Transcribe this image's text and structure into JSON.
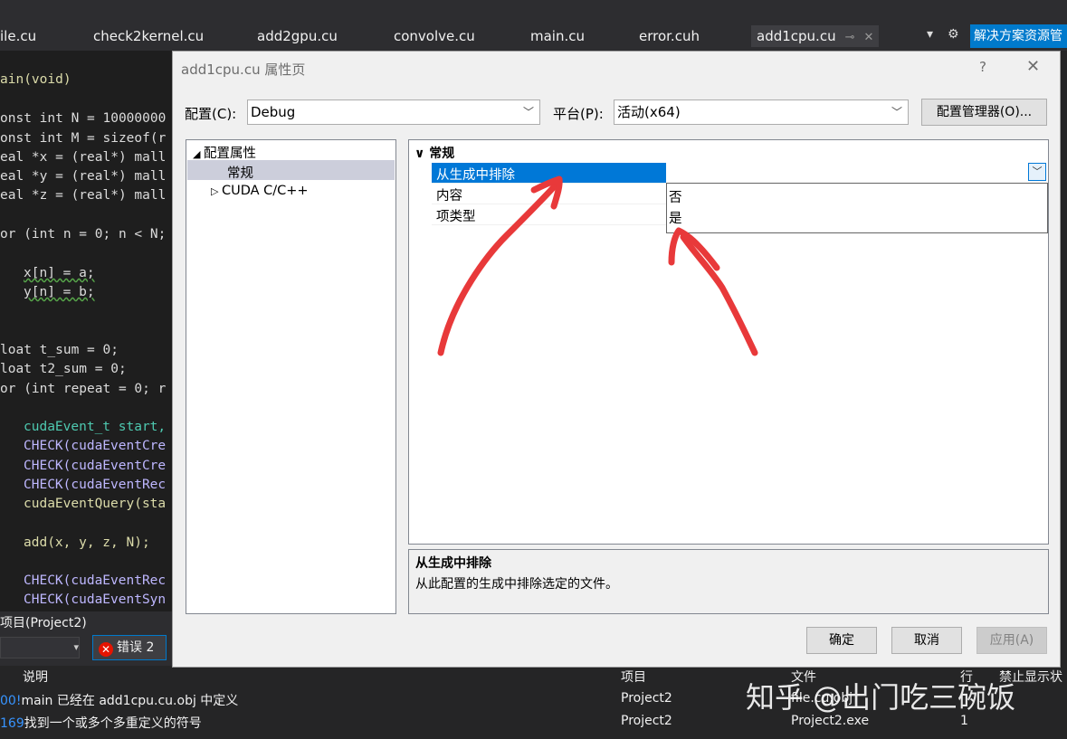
{
  "tabs": [
    {
      "label": "ile.cu"
    },
    {
      "label": "check2kernel.cu"
    },
    {
      "label": "add2gpu.cu"
    },
    {
      "label": "convolve.cu"
    },
    {
      "label": "main.cu"
    },
    {
      "label": "error.cuh"
    },
    {
      "label": "add1cpu.cu",
      "active": true
    }
  ],
  "solution_explorer_label": "解决方案资源管",
  "code_lines": [
    "ain(void)",
    "onst int N = 10000000",
    "onst int M = sizeof(r",
    "eal *x = (real*) mall",
    "eal *y = (real*) mall",
    "eal *z = (real*) mall",
    "or (int n = 0; n < N;",
    "x[n] = a;",
    "y[n] = b;",
    "loat t_sum = 0;",
    "loat t2_sum = 0;",
    "or (int repeat = 0; r",
    "cudaEvent_t start,",
    "CHECK(cudaEventCre",
    "CHECK(cudaEventCre",
    "CHECK(cudaEventRec",
    "cudaEventQuery(sta",
    "add(x, y, z, N);",
    "CHECK(cudaEventRec",
    "CHECK(cudaEventSyn"
  ],
  "error_panel": {
    "title": "项目(Project2)",
    "error_button": "错误 2",
    "columns": {
      "desc": "说明",
      "project": "项目",
      "file": "文件",
      "line": "行",
      "suppress": "禁止显示状"
    },
    "rows": [
      {
        "code": "00!",
        "desc": "main 已经在 add1cpu.cu.obj 中定义",
        "project": "Project2",
        "file": "file.cu.obj",
        "line": ""
      },
      {
        "code": "169",
        "desc": "找到一个或多个多重定义的符号",
        "project": "Project2",
        "file": "Project2.exe",
        "line": "1"
      }
    ]
  },
  "watermark": "知乎 @出门吃三碗饭",
  "dialog": {
    "title": "add1cpu.cu 属性页",
    "help": "?",
    "config_label": "配置(C):",
    "config_value": "Debug",
    "platform_label": "平台(P):",
    "platform_value": "活动(x64)",
    "config_manager": "配置管理器(O)...",
    "tree": {
      "root": "配置属性",
      "general": "常规",
      "cuda": "CUDA C/C++"
    },
    "grid": {
      "category": "常规",
      "rows": [
        "从生成中排除",
        "内容",
        "项类型"
      ],
      "options": [
        "否",
        "是"
      ]
    },
    "description": {
      "title": "从生成中排除",
      "text": "从此配置的生成中排除选定的文件。"
    },
    "ok": "确定",
    "cancel": "取消",
    "apply": "应用(A)"
  },
  "colors": {
    "accent": "#0078d7",
    "vs_blue": "#007acc",
    "annotation_red": "#e8393a",
    "error_red": "#e51400"
  }
}
